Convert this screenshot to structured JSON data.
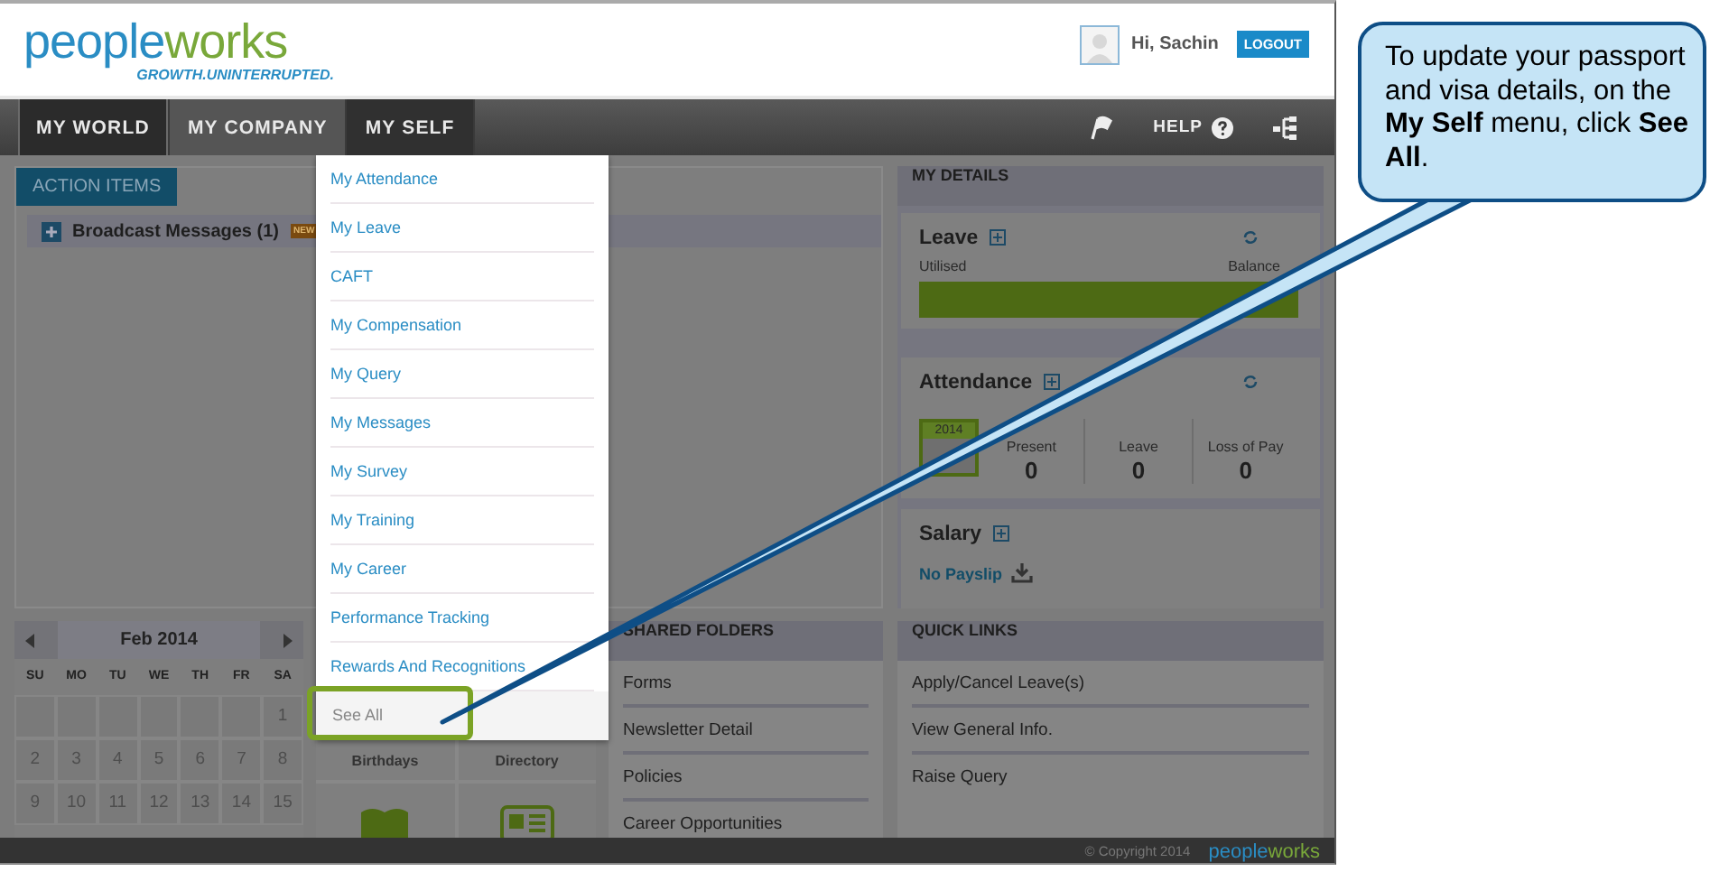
{
  "header": {
    "logo_first": "people",
    "logo_second": "works",
    "tagline": "GROWTH.UNINTERRUPTED.",
    "greeting": "Hi, Sachin",
    "logout": "LOGOUT"
  },
  "nav": {
    "tabs": [
      {
        "label": "MY WORLD",
        "selected": true,
        "expanded": false
      },
      {
        "label": "MY COMPANY",
        "selected": false,
        "expanded": false
      },
      {
        "label": "MY SELF",
        "selected": false,
        "expanded": true
      }
    ],
    "help": "HELP"
  },
  "action_items": {
    "tab": "ACTION ITEMS",
    "broadcast": "Broadcast Messages (1)",
    "badge": "NEW"
  },
  "menu": {
    "items": [
      {
        "label": "My Attendance",
        "highlighted": false
      },
      {
        "label": "My Leave",
        "highlighted": false
      },
      {
        "label": "CAFT",
        "highlighted": false
      },
      {
        "label": "My Compensation",
        "highlighted": false
      },
      {
        "label": "My Query",
        "highlighted": false
      },
      {
        "label": "My Messages",
        "highlighted": false
      },
      {
        "label": "My Survey",
        "highlighted": false
      },
      {
        "label": "My Training",
        "highlighted": false
      },
      {
        "label": "My Career",
        "highlighted": false
      },
      {
        "label": "Performance Tracking",
        "highlighted": false
      },
      {
        "label": "Rewards And Recognitions",
        "highlighted": false
      },
      {
        "label": "See All",
        "highlighted": true
      }
    ]
  },
  "calendar": {
    "month": "Feb 2014",
    "weekdays": [
      "SU",
      "MO",
      "TU",
      "WE",
      "TH",
      "FR",
      "SA"
    ],
    "weeks": [
      [
        {
          "kind": "blank"
        },
        {
          "kind": "blank"
        },
        {
          "kind": "blank"
        },
        {
          "kind": "blank"
        },
        {
          "kind": "blank"
        },
        {
          "kind": "blank"
        },
        {
          "kind": "day",
          "label": "1"
        }
      ],
      [
        {
          "kind": "day",
          "label": "2"
        },
        {
          "kind": "day",
          "label": "3"
        },
        {
          "kind": "day",
          "label": "4"
        },
        {
          "kind": "day",
          "label": "5"
        },
        {
          "kind": "day",
          "label": "6"
        },
        {
          "kind": "day",
          "label": "7"
        },
        {
          "kind": "day",
          "label": "8"
        }
      ],
      [
        {
          "kind": "day",
          "label": "9"
        },
        {
          "kind": "day",
          "label": "10"
        },
        {
          "kind": "day",
          "label": "11"
        },
        {
          "kind": "day",
          "label": "12"
        },
        {
          "kind": "day",
          "label": "13"
        },
        {
          "kind": "day",
          "label": "14"
        },
        {
          "kind": "day",
          "label": "15"
        }
      ]
    ]
  },
  "widgets": [
    {
      "label": "Birthdays"
    },
    {
      "label": "Directory"
    }
  ],
  "shared_folders": {
    "title": "SHARED FOLDERS",
    "items": [
      "Forms",
      "Newsletter Detail",
      "Policies",
      "Career Opportunities"
    ]
  },
  "my_details": {
    "title": "MY DETAILS",
    "leave": {
      "title": "Leave",
      "utilised": "Utilised",
      "balance": "Balance"
    },
    "attendance": {
      "title": "Attendance",
      "year": "2014",
      "stats": [
        {
          "label": "Present",
          "value": "0"
        },
        {
          "label": "Leave",
          "value": "0"
        },
        {
          "label": "Loss of Pay",
          "value": "0"
        }
      ]
    },
    "salary": {
      "title": "Salary",
      "payslip": "No Payslip"
    }
  },
  "quick_links": {
    "title": "QUICK LINKS",
    "items": [
      "Apply/Cancel Leave(s)",
      "View General Info.",
      "Raise Query"
    ]
  },
  "footer": {
    "copyright": "© Copyright 2014",
    "logo_first": "people",
    "logo_second": "works"
  },
  "callout": "To update your passport and visa details, on the **My Self** menu, click **See All**."
}
